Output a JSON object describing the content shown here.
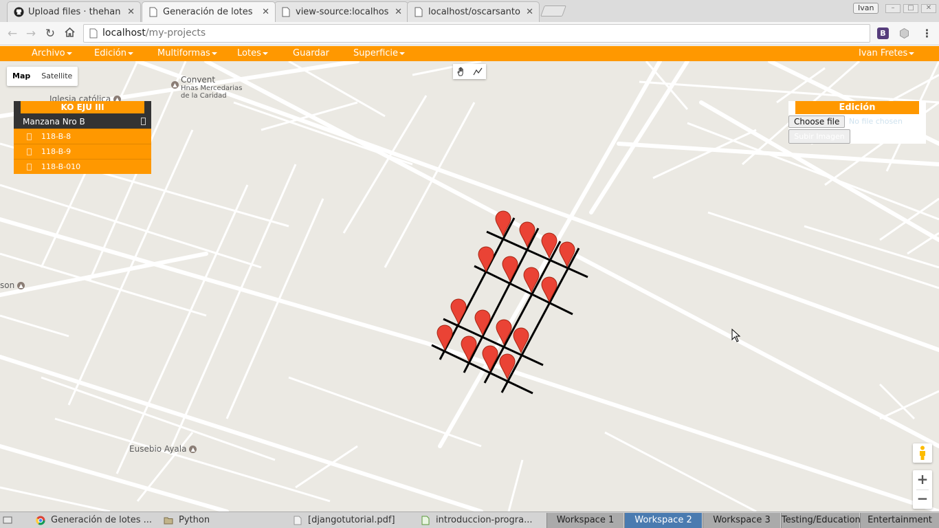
{
  "browser": {
    "tabs": [
      {
        "title": "Upload files · thehan",
        "icon": "github-icon"
      },
      {
        "title": "Generación de lotes",
        "icon": "page-icon",
        "active": true
      },
      {
        "title": "view-source:localhos",
        "icon": "page-icon"
      },
      {
        "title": "localhost/oscarsanto",
        "icon": "page-icon"
      }
    ],
    "profile_name": "Ivan",
    "url_host": "localhost",
    "url_path": "/my-projects",
    "close_glyph": "✕"
  },
  "menubar": {
    "items": [
      "Archivo",
      "Edición",
      "Multiformas",
      "Lotes",
      "Guardar",
      "Superficie"
    ],
    "user": "Ivan Fretes"
  },
  "map": {
    "map_type": [
      "Map",
      "Satellite"
    ],
    "pois": {
      "convent_line1": "Convent",
      "convent_line2": "Hnas Mercedarias",
      "convent_line3": "de la Caridad",
      "church": "Iglesia católica",
      "left_poi": "son",
      "eusebio": "Eusebio Ayala"
    },
    "zoom_in": "+",
    "zoom_out": "−"
  },
  "lotes_panel": {
    "title": "KO EJU III",
    "group": "Manzana Nro B",
    "lots": [
      "118-B-8",
      "118-B-9",
      "118-B-010"
    ]
  },
  "edit_panel": {
    "title": "Edición",
    "file_button": "Choose file",
    "file_status": "No file chosen",
    "upload_button": "Subir Imagen"
  },
  "taskbar": {
    "tasks": [
      {
        "label": "Generación de lotes ...",
        "icon": "chrome-icon"
      },
      {
        "label": "Python",
        "icon": "folder-icon"
      },
      {
        "label": "[djangotutorial.pdf]",
        "icon": "pdf-icon"
      },
      {
        "label": "introduccion-progra...",
        "icon": "document-icon"
      }
    ],
    "workspaces": [
      "Workspace 1",
      "Workspace 2",
      "Workspace 3",
      "Testing/Education",
      "Entertainment"
    ]
  }
}
